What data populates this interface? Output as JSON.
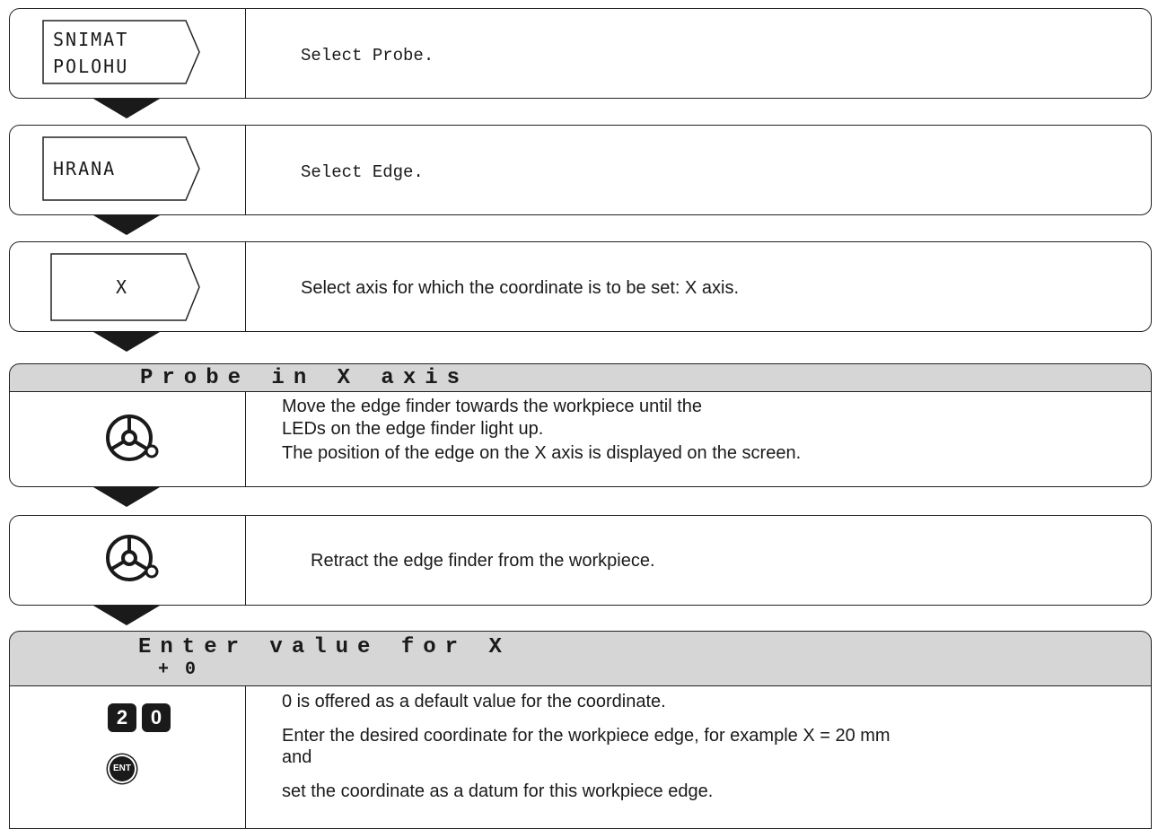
{
  "steps": [
    {
      "softkey_lines": [
        "SNIMAT",
        "POLOHU"
      ],
      "text": "Select Probe."
    },
    {
      "softkey_lines": [
        "HRANA"
      ],
      "text": "Select Edge."
    },
    {
      "softkey_lines": [
        "X"
      ],
      "text": "Select axis for which the coordinate is to be set: X axis."
    }
  ],
  "dialog1": {
    "title": "Probe in X axis"
  },
  "step4": {
    "icon": "handwheel-icon",
    "lines": [
      "Move the edge finder towards the workpiece until the",
      "LEDs on the edge finder light up.",
      "The position of the edge on the X axis is displayed on the screen."
    ]
  },
  "step5": {
    "icon": "handwheel-icon",
    "text": "Retract the edge finder from the workpiece."
  },
  "dialog2": {
    "title": "Enter value for X",
    "value": "+ 0"
  },
  "step6": {
    "keys": [
      "2",
      "0"
    ],
    "ent_label": "ENT",
    "lines": [
      "0 is offered as a default value for the coordinate.",
      "Enter the desired coordinate for the workpiece edge, for example X = 20 mm",
      "and",
      "set the coordinate as a datum for this workpiece edge."
    ]
  }
}
